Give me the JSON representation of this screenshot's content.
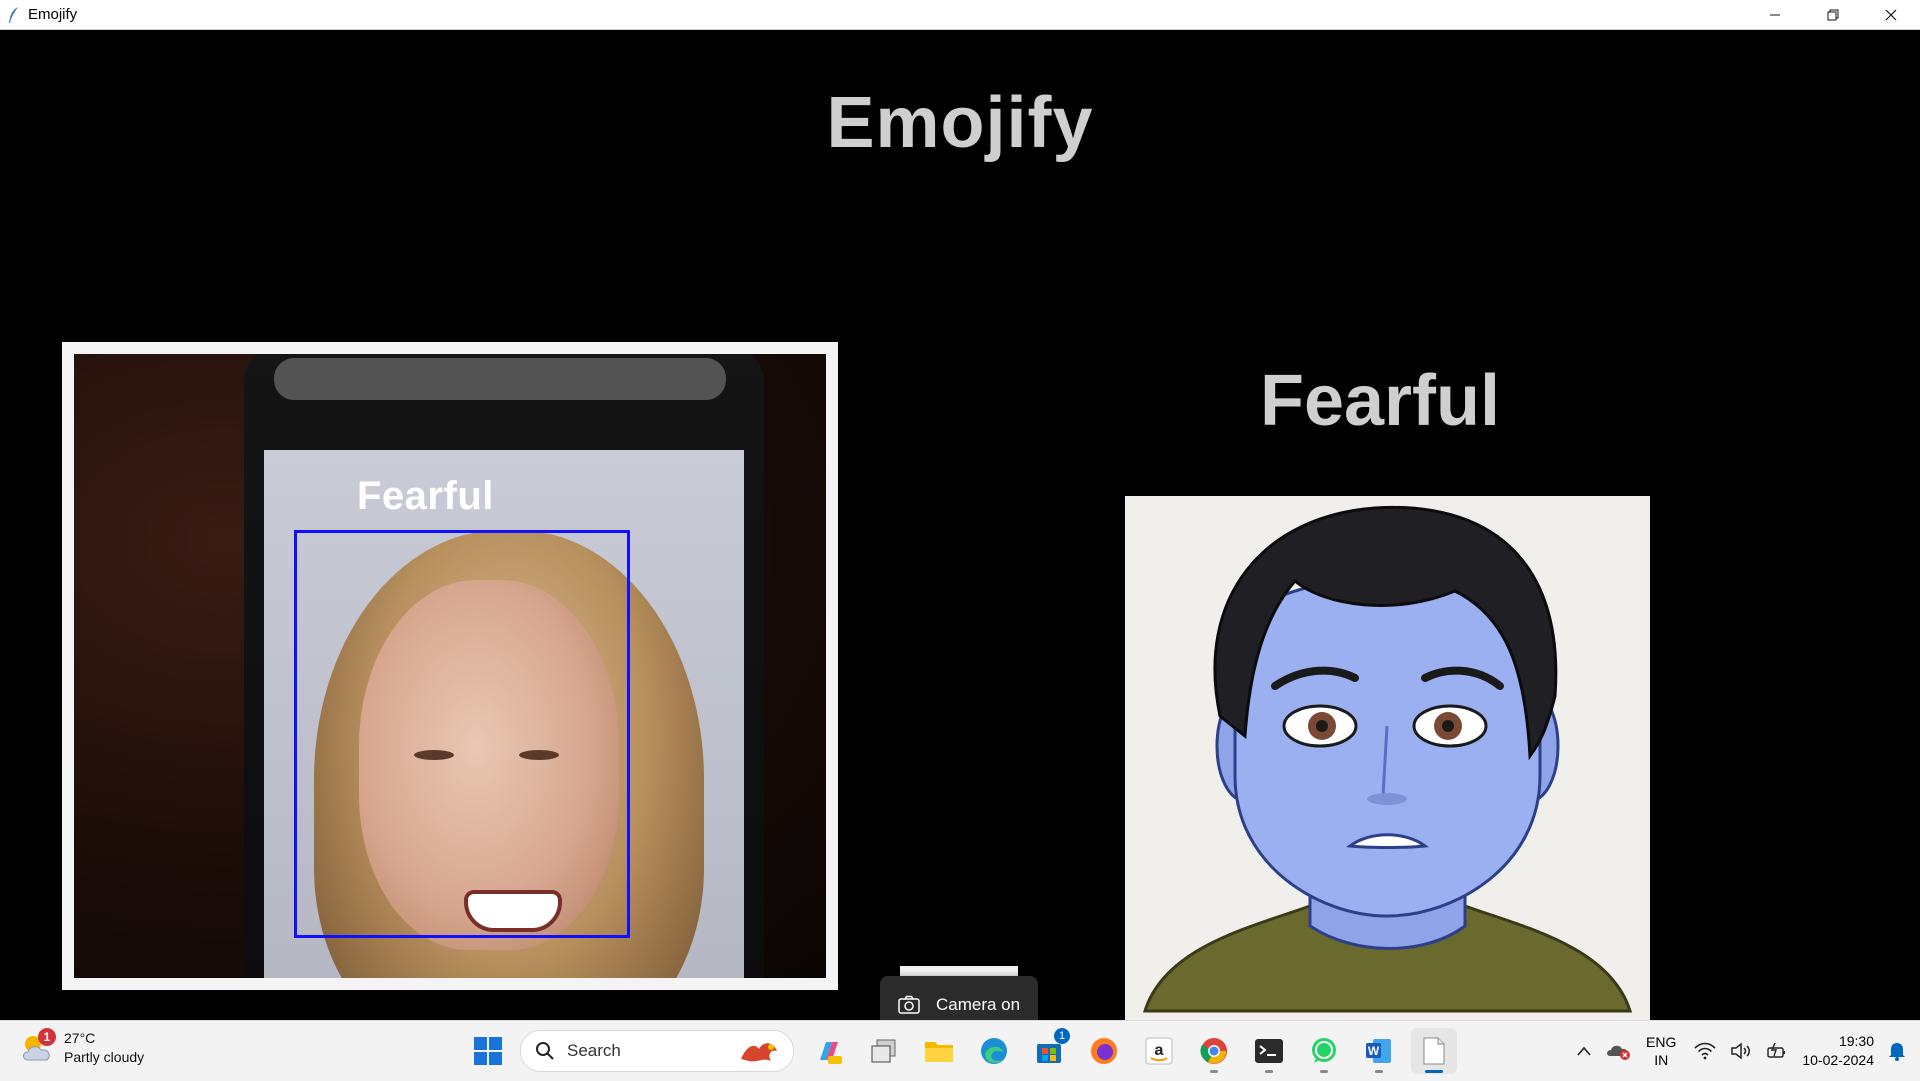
{
  "window": {
    "title": "Emojify",
    "controls": [
      "minimize",
      "restore",
      "close"
    ]
  },
  "app": {
    "heading": "Emojify",
    "detected_label": "Fearful",
    "emotion_label": "Fearful"
  },
  "camera_notice": {
    "text": "Camera on"
  },
  "taskbar": {
    "weather": {
      "badge": "1",
      "temp": "27°C",
      "condition": "Partly cloudy"
    },
    "search": {
      "label": "Search"
    },
    "apps": [
      {
        "name": "copilot",
        "badge": ""
      },
      {
        "name": "task-view",
        "badge": ""
      },
      {
        "name": "file-explorer",
        "badge": ""
      },
      {
        "name": "edge",
        "badge": ""
      },
      {
        "name": "microsoft-store",
        "badge": "1"
      },
      {
        "name": "firefox",
        "badge": ""
      },
      {
        "name": "amazon",
        "badge": ""
      },
      {
        "name": "chrome",
        "badge": ""
      },
      {
        "name": "terminal",
        "badge": ""
      },
      {
        "name": "whatsapp",
        "badge": ""
      },
      {
        "name": "word",
        "badge": ""
      },
      {
        "name": "notepad",
        "badge": ""
      }
    ],
    "tray": {
      "lang_top": "ENG",
      "lang_bottom": "IN",
      "time": "19:30",
      "date": "10-02-2024"
    }
  },
  "colors": {
    "heading": "#cfcfcf",
    "face_box": "#1010ff",
    "accent": "#0067c0"
  }
}
